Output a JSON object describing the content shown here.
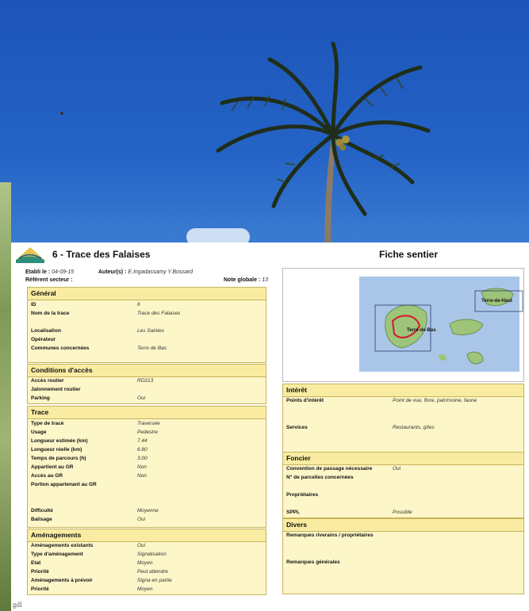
{
  "header": {
    "title": "6 - Trace des Falaises",
    "doc_type": "Fiche sentier",
    "etabli_label": "Etabli le :",
    "etabli_value": "04-09-15",
    "auteurs_label": "Auteur(s) :",
    "auteurs_value": "E.Ingadassamy Y.Bossard",
    "referent_label": "Référent secteur :",
    "note_label": "Note globale :",
    "note_value": "13"
  },
  "general": {
    "title": "Général",
    "rows": [
      {
        "label": "ID",
        "value": "6"
      },
      {
        "label": "Nom de la trace",
        "value": "Trace des Falaises"
      },
      {
        "label": "Localisation",
        "value": "Les Saintes"
      },
      {
        "label": "Opérateur",
        "value": ""
      },
      {
        "label": "Communes concernées",
        "value": "Terre de Bas"
      }
    ]
  },
  "acces": {
    "title": "Conditions d'accès",
    "rows": [
      {
        "label": "Accès routier",
        "value": "RD213"
      },
      {
        "label": "Jalonnement routier",
        "value": ""
      },
      {
        "label": "Parking",
        "value": "Oui"
      }
    ]
  },
  "trace": {
    "title": "Trace",
    "rows": [
      {
        "label": "Type de tracé",
        "value": "Traversée"
      },
      {
        "label": "Usage",
        "value": "Pedestre"
      },
      {
        "label": "Longueur estimée (km)",
        "value": "7.44"
      },
      {
        "label": "Longueur réelle (km)",
        "value": "6.80"
      },
      {
        "label": "Temps de parcours (h)",
        "value": "3.00"
      },
      {
        "label": "Appartient au GR",
        "value": "Non"
      },
      {
        "label": "Accès au GR",
        "value": "Non"
      },
      {
        "label": "Portion appartenant au GR",
        "value": ""
      },
      {
        "label": "Difficulté",
        "value": "Moyenne"
      },
      {
        "label": "Balisage",
        "value": "Oui"
      }
    ]
  },
  "amenagements": {
    "title": "Aménagements",
    "rows": [
      {
        "label": "Aménagements existants",
        "value": "Oui"
      },
      {
        "label": "Type d'aménagement",
        "value": "Signalisation"
      },
      {
        "label": "Etat",
        "value": "Moyen"
      },
      {
        "label": "Priorité",
        "value": "Peut attendre"
      },
      {
        "label": "Aménagements à prévoir",
        "value": "Signa en partie"
      },
      {
        "label": "Priorité",
        "value": "Moyen"
      }
    ]
  },
  "interet": {
    "title": "Intérêt",
    "rows": [
      {
        "label": "Points d'intérêt",
        "value": "Point de vue, flore, patrimoine, faune"
      },
      {
        "label": "Services",
        "value": "Restaurants, gîtes"
      }
    ]
  },
  "foncier": {
    "title": "Foncier",
    "rows": [
      {
        "label": "Convention de passage nécessaire",
        "value": "Oui"
      },
      {
        "label": "N° de parcelles concernées",
        "value": ""
      },
      {
        "label": "Propriétaires",
        "value": ""
      },
      {
        "label": "SPPL",
        "value": "Possible"
      }
    ]
  },
  "divers": {
    "title": "Divers",
    "rows": [
      {
        "label": "Remarques riverains / propriétaires",
        "value": ""
      },
      {
        "label": "Remarques générales",
        "value": ""
      }
    ]
  },
  "map": {
    "label_left": "Terre-de-Bas",
    "label_right": "Terre-de-Haut"
  },
  "footer": {
    "logo_text": "gdl"
  },
  "colors": {
    "box_fill": "#fdf6c8",
    "box_head": "#f9eca2",
    "box_border": "#c7b35a",
    "sky": "#2463c6"
  }
}
